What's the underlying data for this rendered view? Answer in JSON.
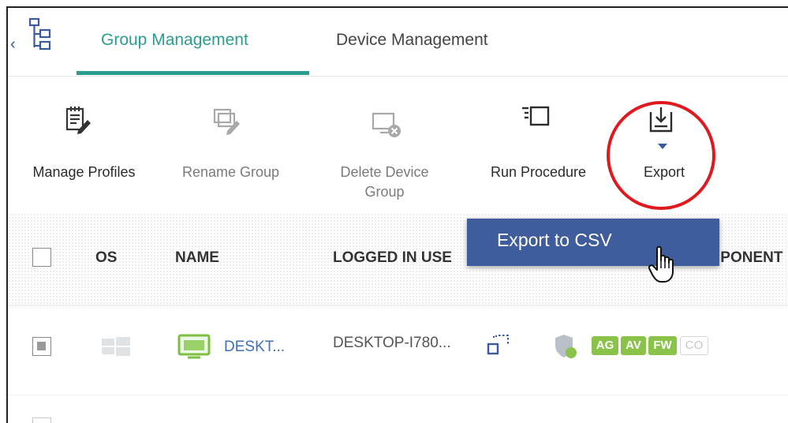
{
  "tabs": {
    "group": "Group Management",
    "device": "Device Management"
  },
  "toolbar": {
    "manage_profiles": "Manage Profiles",
    "rename_group": "Rename Group",
    "delete_line1": "Delete Device",
    "delete_line2": "Group",
    "run_procedure": "Run Procedure",
    "export": "Export"
  },
  "menu": {
    "export_csv": "Export to CSV"
  },
  "table": {
    "headers": {
      "os": "OS",
      "name": "NAME",
      "logged_in_user": "LOGGED IN USE",
      "components": "IPONENT"
    },
    "row": {
      "name": "DESKT...",
      "logged_in_user": "DESKTOP-I780...",
      "badges": [
        "AG",
        "AV",
        "FW",
        "CO"
      ]
    }
  },
  "colors": {
    "accent": "#2a9d8f",
    "menu_bg": "#3f5d9c",
    "badge_green": "#8bc34a",
    "highlight": "#e0191f",
    "link_blue": "#3f6fb5"
  },
  "icons": {
    "tree": "hierarchy-icon",
    "manage_profiles": "clipboard-edit-icon",
    "rename_group": "rename-group-icon",
    "delete_group": "delete-monitor-icon",
    "run_procedure": "run-procedure-icon",
    "export": "export-download-icon"
  }
}
